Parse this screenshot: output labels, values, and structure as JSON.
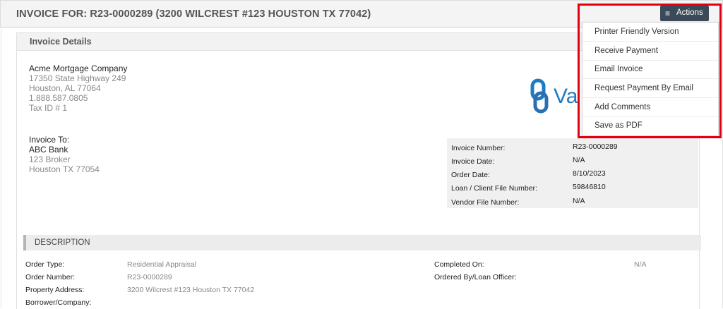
{
  "header": {
    "title": "INVOICE FOR: R23-0000289 (3200 WILCREST #123 HOUSTON TX 77042)",
    "actions_label": "Actions",
    "actions_icon": "menu-icon"
  },
  "actions_menu": {
    "items": [
      {
        "label": "Printer Friendly Version"
      },
      {
        "label": "Receive Payment"
      },
      {
        "label": "Email Invoice"
      },
      {
        "label": "Request Payment By Email"
      },
      {
        "label": "Add Comments"
      },
      {
        "label": "Save as PDF"
      }
    ]
  },
  "details": {
    "title": "Invoice Details",
    "company": {
      "name": "Acme Mortgage Company",
      "address1": "17350 State Highway 249",
      "address2": "Houston, AL 77064",
      "phone": "1.888.587.0805",
      "tax_id": "Tax ID # 1"
    },
    "invoice_to": {
      "label": "Invoice To:",
      "name": "ABC Bank",
      "address1": "123 Broker",
      "address2": "Houston TX 77054"
    },
    "logo_text": "Va",
    "info": [
      {
        "key": "Invoice Number:",
        "value": "R23-0000289"
      },
      {
        "key": "Invoice Date:",
        "value": "N/A"
      },
      {
        "key": "Order Date:",
        "value": "8/10/2023"
      },
      {
        "key": "Loan / Client File Number:",
        "value": "59846810"
      },
      {
        "key": "Vendor File Number:",
        "value": "N/A"
      }
    ]
  },
  "description": {
    "title": "DESCRIPTION",
    "left": [
      {
        "label": "Order Type:",
        "value": "Residential Appraisal"
      },
      {
        "label": "Order Number:",
        "value": "R23-0000289"
      },
      {
        "label": "Property Address:",
        "value": "3200 Wilcrest #123 Houston TX 77042"
      },
      {
        "label": "Borrower/Company:",
        "value": ""
      }
    ],
    "right": [
      {
        "label": "Completed On:",
        "value": "N/A"
      },
      {
        "label": "Ordered By/Loan Officer:",
        "value": ""
      }
    ]
  },
  "colors": {
    "accent_dark": "#3a4a58",
    "highlight_red": "#e0000f",
    "logo_blue": "#1e7bc4"
  }
}
